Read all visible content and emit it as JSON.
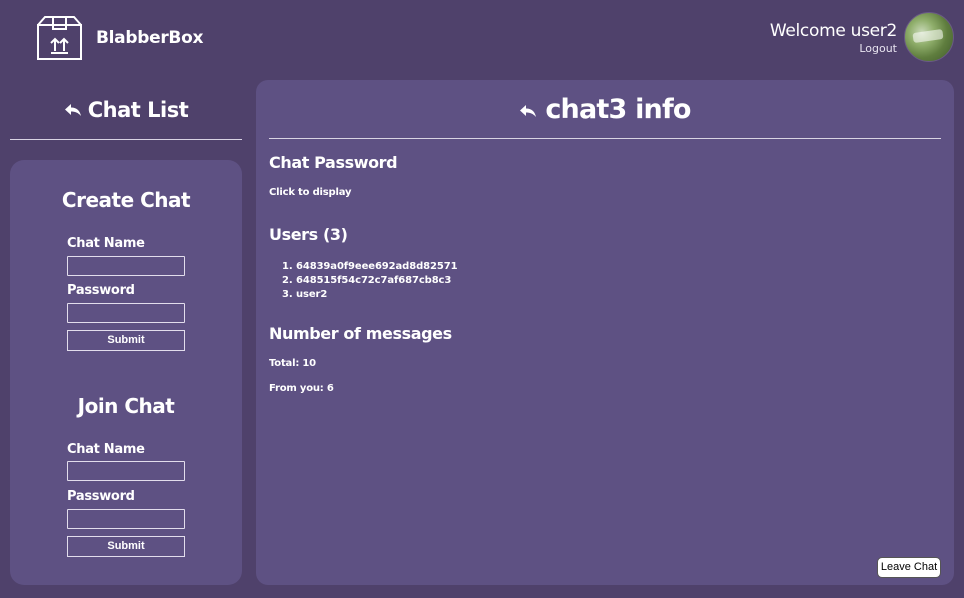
{
  "header": {
    "brand": "BlabberBox",
    "logo_icon": "package-box-icon",
    "welcome": "Welcome user2",
    "logout": "Logout",
    "avatar_icon": "user-avatar-image"
  },
  "sidebar": {
    "chat_list_title": "Chat List",
    "back_icon": "reply-arrow-icon",
    "create": {
      "title": "Create Chat",
      "name_label": "Chat Name",
      "name_value": "",
      "password_label": "Password",
      "password_value": "",
      "submit": "Submit"
    },
    "join": {
      "title": "Join Chat",
      "name_label": "Chat Name",
      "name_value": "",
      "password_label": "Password",
      "password_value": "",
      "submit": "Submit"
    }
  },
  "main": {
    "title": "chat3 info",
    "password_heading": "Chat Password",
    "password_reveal": "Click to display",
    "users_heading": "Users (3)",
    "users": [
      "64839a0f9eee692ad8d82571",
      "648515f54c72c7af687cb8c3",
      "user2"
    ],
    "messages_heading": "Number of messages",
    "total": "Total: 10",
    "from_you": "From you: 6",
    "leave_button": "Leave Chat"
  },
  "colors": {
    "background": "#4f416b",
    "panel": "#5e5183",
    "text": "#ffffff"
  }
}
